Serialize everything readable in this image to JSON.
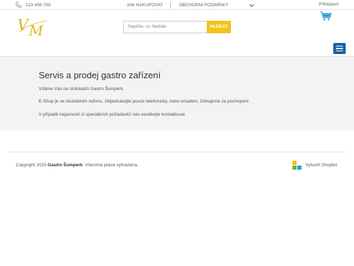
{
  "topbar": {
    "phone": "123 456 789",
    "nav": [
      "JAK NAKUPOVAT",
      "OBCHODNÍ PODMÍNKY"
    ],
    "login": "Přihlášení"
  },
  "header": {
    "logo_text": "VM",
    "search_placeholder": "Napište, co hledáte",
    "search_button": "HLEDAT"
  },
  "main": {
    "title": "Servis a prodej gastro zařízení",
    "paragraphs": [
      "Vítáme Vás na stránkách Gastro Šumperk.",
      "E-Shop je ve zkušebním režimu. Objednávejte pouze telefonicky, nebo emailem. Děkujeme za pochopení.",
      "V případě nejasností či speciálních požadavků nás neváhejte kontaktovat."
    ]
  },
  "footer": {
    "copyright_prefix": "Copyright 2025",
    "copyright_brand": "Gastro Šumperk",
    "copyright_suffix": ". Všechna práva vyhrazena.",
    "shoptet": "Vytvořil Shoptet"
  },
  "colors": {
    "accent_yellow": "#f3c21c",
    "menu_blue": "#1e5fa6",
    "cart_blue": "#2a9fd6"
  }
}
